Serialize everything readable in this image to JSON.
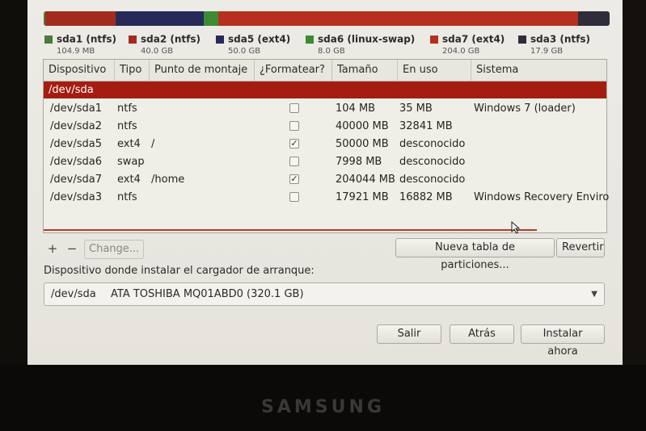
{
  "partition_bar": {
    "segments": [
      {
        "name": "sda1",
        "color": "#4a7a3c",
        "fraction": 0.0003
      },
      {
        "name": "sda2",
        "color": "#a22b1f",
        "fraction": 0.125
      },
      {
        "name": "sda5",
        "color": "#272a58",
        "fraction": 0.156
      },
      {
        "name": "sda6",
        "color": "#3d8a35",
        "fraction": 0.025
      },
      {
        "name": "sda7",
        "color": "#b5301f",
        "fraction": 0.638
      },
      {
        "name": "sda3",
        "color": "#2f2c3c",
        "fraction": 0.056
      }
    ]
  },
  "legend": [
    {
      "label": "sda1 (ntfs)",
      "size": "104.9 MB",
      "color": "#4a7a3c"
    },
    {
      "label": "sda2 (ntfs)",
      "size": "40.0 GB",
      "color": "#a22b1f"
    },
    {
      "label": "sda5 (ext4)",
      "size": "50.0 GB",
      "color": "#272a58"
    },
    {
      "label": "sda6 (linux-swap)",
      "size": "8.0 GB",
      "color": "#3d8a35"
    },
    {
      "label": "sda7 (ext4)",
      "size": "204.0 GB",
      "color": "#b5301f"
    },
    {
      "label": "sda3 (ntfs)",
      "size": "17.9 GB",
      "color": "#2f2c3c"
    }
  ],
  "table": {
    "columns": [
      "Dispositivo",
      "Tipo",
      "Punto de montaje",
      "¿Formatear?",
      "Tamaño",
      "En uso",
      "Sistema"
    ],
    "device": "/dev/sda",
    "rows": [
      {
        "device": "/dev/sda1",
        "type": "ntfs",
        "mount": "",
        "format": false,
        "size": "104 MB",
        "used": "35 MB",
        "system": "Windows 7 (loader)"
      },
      {
        "device": "/dev/sda2",
        "type": "ntfs",
        "mount": "",
        "format": false,
        "size": "40000 MB",
        "used": "32841 MB",
        "system": ""
      },
      {
        "device": "/dev/sda5",
        "type": "ext4",
        "mount": "/",
        "format": true,
        "size": "50000 MB",
        "used": "desconocido",
        "system": ""
      },
      {
        "device": "/dev/sda6",
        "type": "swap",
        "mount": "",
        "format": false,
        "size": "7998 MB",
        "used": "desconocido",
        "system": ""
      },
      {
        "device": "/dev/sda7",
        "type": "ext4",
        "mount": "/home",
        "format": true,
        "size": "204044 MB",
        "used": "desconocido",
        "system": ""
      },
      {
        "device": "/dev/sda3",
        "type": "ntfs",
        "mount": "",
        "format": false,
        "size": "17921 MB",
        "used": "16882 MB",
        "system": "Windows Recovery Enviro"
      }
    ]
  },
  "tools": {
    "add": "+",
    "remove": "−",
    "change": "Change..."
  },
  "actions": {
    "new_table": "Nueva tabla de particiones...",
    "revert": "Revertir"
  },
  "bootloader": {
    "label": "Dispositivo donde instalar el cargador de arranque:",
    "device": "/dev/sda",
    "model": "ATA TOSHIBA MQ01ABD0 (320.1 GB)"
  },
  "footer": {
    "quit": "Salir",
    "back": "Atrás",
    "install": "Instalar ahora"
  },
  "brand": "SAMSUNG"
}
